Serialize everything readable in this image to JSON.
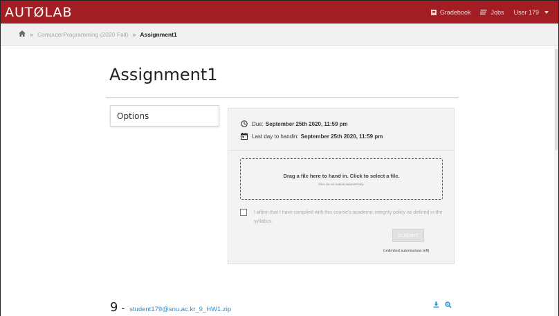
{
  "navbar": {
    "logo": "AUTØLAB",
    "links": [
      {
        "label": "Gradebook",
        "icon": "gradebook-icon"
      },
      {
        "label": "Jobs",
        "icon": "jobs-icon"
      }
    ],
    "user": "User 179"
  },
  "breadcrumb": {
    "home_icon": "home-icon",
    "course": "ComputerProgramming (2020 Fall)",
    "current": "Assignment1"
  },
  "page": {
    "title": "Assignment1"
  },
  "options": {
    "label": "Options"
  },
  "handin": {
    "due_label": "Due:",
    "due_value": "September 25th 2020, 11:59 pm",
    "last_day_label": "Last day to handin:",
    "last_day_value": "September 25th 2020, 11:59 pm",
    "dropzone_main": "Drag a file here to hand in. Click to select a file.",
    "dropzone_sub": "Files do not submit automatically.",
    "affirm_text": "I affirm that I have complied with this course's academic integrity policy as defined in the syllabus.",
    "affirm_checked": false,
    "submit_label": "SUBMIT",
    "remaining": "(unlimited submissions left)"
  },
  "submission": {
    "number": "9",
    "dash": "-",
    "filename": "student179@snu.ac.kr_9_HW1.zip",
    "actions": [
      "download-icon",
      "view-icon"
    ]
  },
  "colors": {
    "navbar": "#a31e22",
    "link": "#2a8fd0"
  }
}
